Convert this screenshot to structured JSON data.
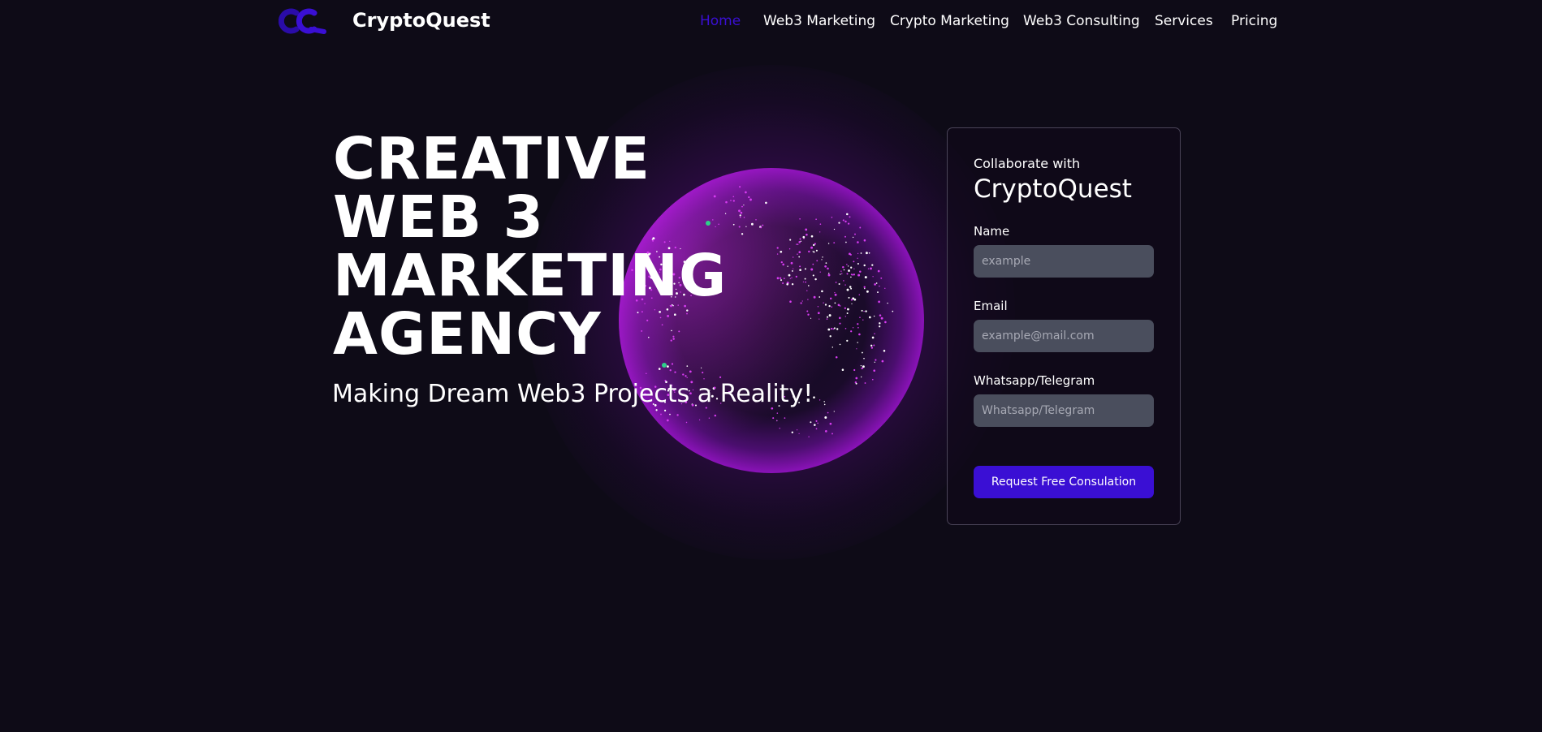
{
  "header": {
    "logo_icon": "cq-logo-icon",
    "brand": "CryptoQuest",
    "nav": [
      {
        "label": "Home",
        "active": true
      },
      {
        "label": "Web3 Marketing",
        "active": false
      },
      {
        "label": "Crypto Marketing",
        "active": false
      },
      {
        "label": "Web3 Consulting",
        "active": false
      },
      {
        "label": "Services",
        "active": false
      },
      {
        "label": "Pricing",
        "active": false
      }
    ]
  },
  "hero": {
    "title_lines": [
      "CREATIVE",
      "WEB 3",
      "MARKETING",
      "AGENCY"
    ],
    "subtitle": "Making Dream Web3 Projects a Reality!",
    "graphic": "particle-globe"
  },
  "form": {
    "eyebrow": "Collaborate with",
    "title": "CryptoQuest",
    "fields": {
      "name": {
        "label": "Name",
        "placeholder": "example",
        "value": ""
      },
      "email": {
        "label": "Email",
        "placeholder": "example@mail.com",
        "value": ""
      },
      "contact": {
        "label": "Whatsapp/Telegram",
        "placeholder": "Whatsapp/Telegram",
        "value": ""
      }
    },
    "submit_label": "Request Free Consulation"
  },
  "colors": {
    "background": "#0e0b17",
    "accent": "#3a0fd4",
    "input_bg": "#4a4e5d",
    "globe_glow": "#7a14aa"
  }
}
